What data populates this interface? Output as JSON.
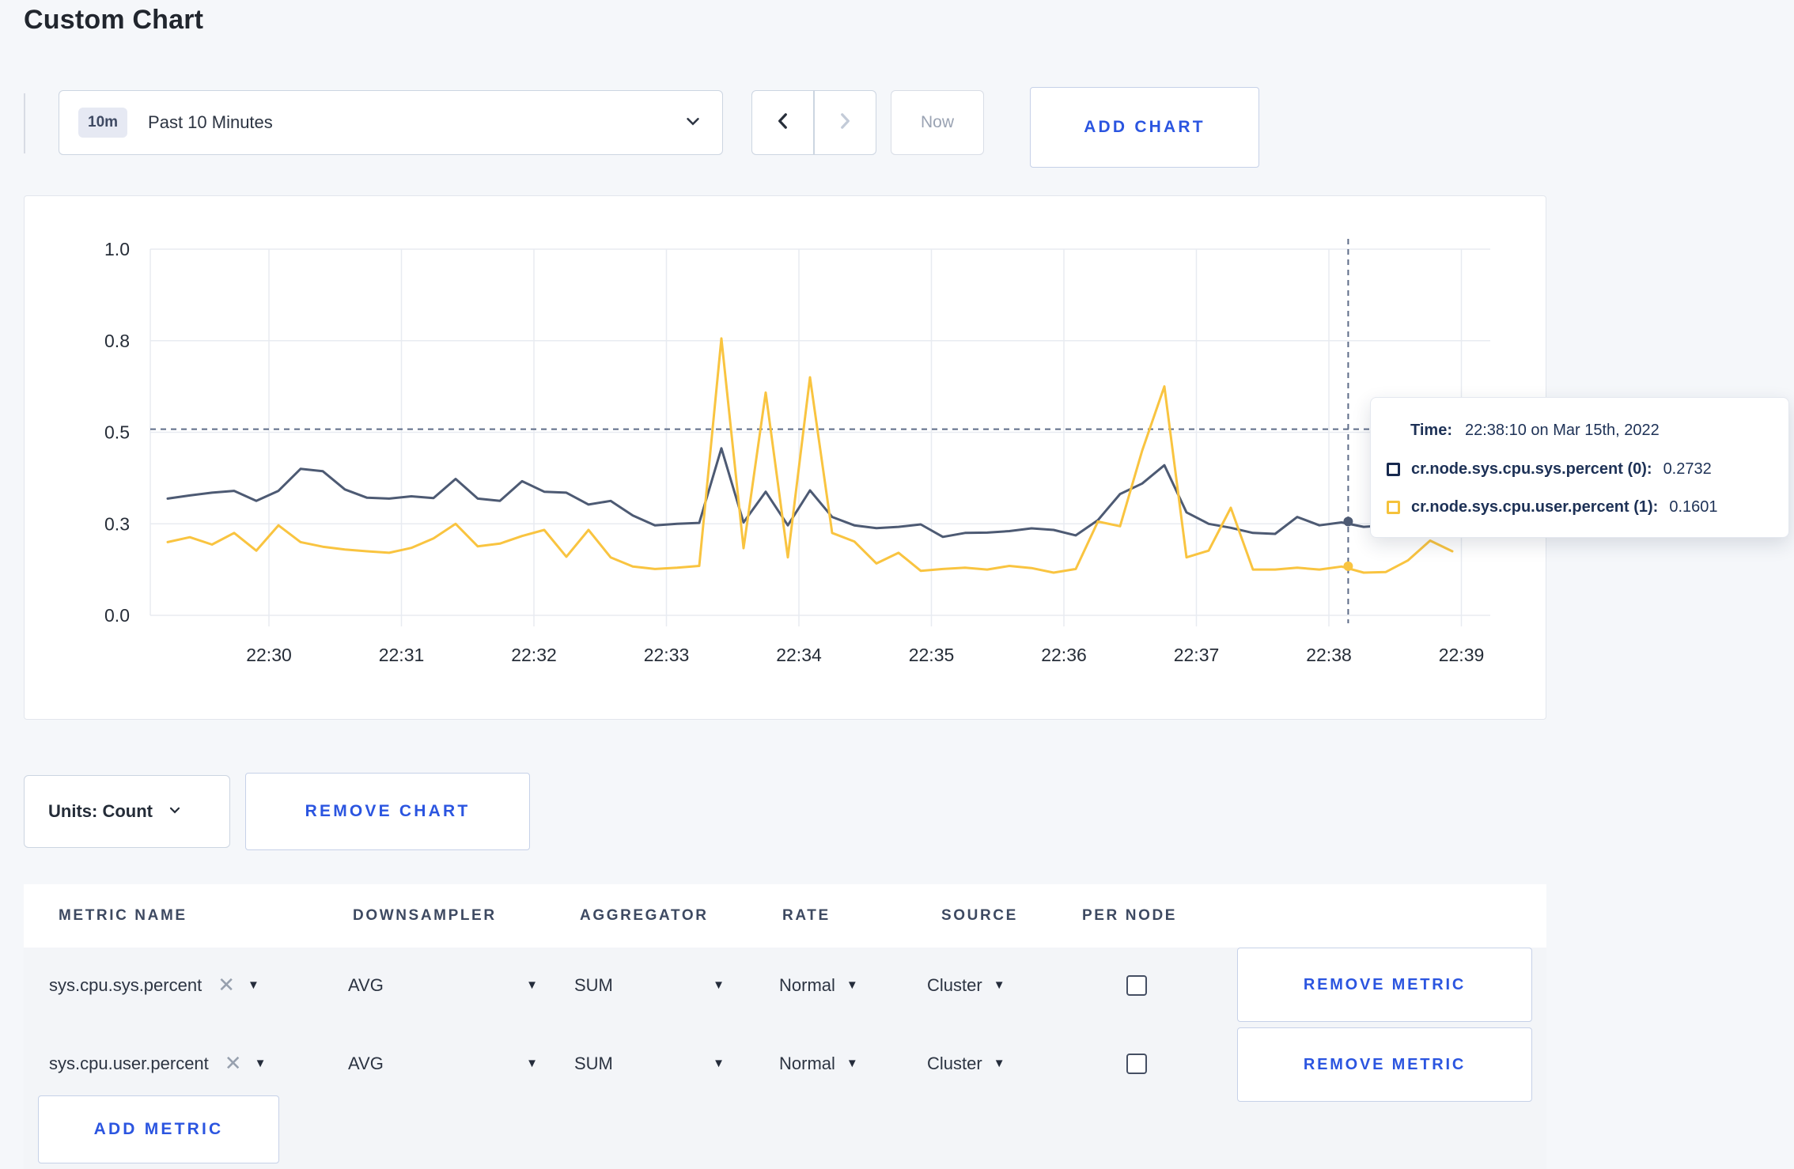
{
  "header": {
    "title": "Custom Chart"
  },
  "toolbar": {
    "timescale": {
      "badge": "10m",
      "label": "Past 10 Minutes"
    },
    "now_label": "Now",
    "add_chart_label": "ADD CHART"
  },
  "chart_data": {
    "type": "line",
    "title": "",
    "xlabel": "",
    "ylabel": "",
    "ylim": [
      0.0,
      1.0
    ],
    "grid": true,
    "y_tick_values": [
      0.0,
      0.3,
      0.5,
      0.8,
      1.0
    ],
    "y_tick_labels": [
      "0.0",
      "0.3",
      "0.5",
      "0.8",
      "1.0"
    ],
    "x_tick_labels": [
      "22:30",
      "22:31",
      "22:32",
      "22:33",
      "22:34",
      "22:35",
      "22:36",
      "22:37",
      "22:38",
      "22:39"
    ],
    "sample_interval_seconds": 10,
    "series": [
      {
        "name": "cr.node.sys.cpu.sys.percent",
        "color": "#4d5a73",
        "values": [
          0.355,
          0.362,
          0.368,
          0.372,
          0.35,
          0.372,
          0.42,
          0.415,
          0.375,
          0.357,
          0.355,
          0.36,
          0.356,
          0.398,
          0.355,
          0.35,
          0.393,
          0.37,
          0.368,
          0.342,
          0.35,
          0.318,
          0.295,
          0.3,
          0.302,
          0.465,
          0.303,
          0.37,
          0.295,
          0.373,
          0.315,
          0.295,
          0.286,
          0.29,
          0.298,
          0.257,
          0.27,
          0.271,
          0.276,
          0.285,
          0.28,
          0.262,
          0.308,
          0.365,
          0.388,
          0.428,
          0.325,
          0.3,
          0.287,
          0.27,
          0.267,
          0.315,
          0.295,
          0.303,
          0.29,
          0.295,
          0.3,
          0.302,
          0.298
        ]
      },
      {
        "name": "cr.node.sys.cpu.user.percent",
        "color": "#f9c440",
        "values": [
          0.24,
          0.256,
          0.232,
          0.27,
          0.212,
          0.295,
          0.24,
          0.225,
          0.216,
          0.21,
          0.205,
          0.221,
          0.252,
          0.3,
          0.226,
          0.235,
          0.26,
          0.28,
          0.192,
          0.28,
          0.19,
          0.16,
          0.152,
          0.156,
          0.162,
          0.805,
          0.22,
          0.63,
          0.19,
          0.68,
          0.27,
          0.242,
          0.17,
          0.205,
          0.146,
          0.152,
          0.156,
          0.15,
          0.162,
          0.155,
          0.14,
          0.152,
          0.305,
          0.292,
          0.46,
          0.65,
          0.19,
          0.212,
          0.335,
          0.15,
          0.15,
          0.156,
          0.15,
          0.16,
          0.14,
          0.142,
          0.18,
          0.245,
          0.21
        ]
      }
    ],
    "legend_position": "none",
    "crosshair": {
      "index": 53.3,
      "hline_value": 0.51,
      "point_values": [
        0.305,
        0.161
      ]
    }
  },
  "tooltip": {
    "time_label": "Time:",
    "time_value": "22:38:10 on Mar 15th, 2022",
    "rows": [
      {
        "name": "cr.node.sys.cpu.sys.percent (0):",
        "value": "0.2732",
        "color": "#17294e"
      },
      {
        "name": "cr.node.sys.cpu.user.percent (1):",
        "value": "0.1601",
        "color": "#f5c23b"
      }
    ]
  },
  "units_bar": {
    "units_label": "Units: Count",
    "remove_chart_label": "REMOVE CHART"
  },
  "metrics_table": {
    "headers": [
      "METRIC NAME",
      "DOWNSAMPLER",
      "AGGREGATOR",
      "RATE",
      "SOURCE",
      "PER NODE"
    ],
    "rows": [
      {
        "metric": "sys.cpu.sys.percent",
        "downsampler": "AVG",
        "aggregator": "SUM",
        "rate": "Normal",
        "source": "Cluster",
        "per_node_checked": false,
        "remove_label": "REMOVE METRIC"
      },
      {
        "metric": "sys.cpu.user.percent",
        "downsampler": "AVG",
        "aggregator": "SUM",
        "rate": "Normal",
        "source": "Cluster",
        "per_node_checked": false,
        "remove_label": "REMOVE METRIC"
      }
    ],
    "add_metric_label": "ADD METRIC"
  }
}
